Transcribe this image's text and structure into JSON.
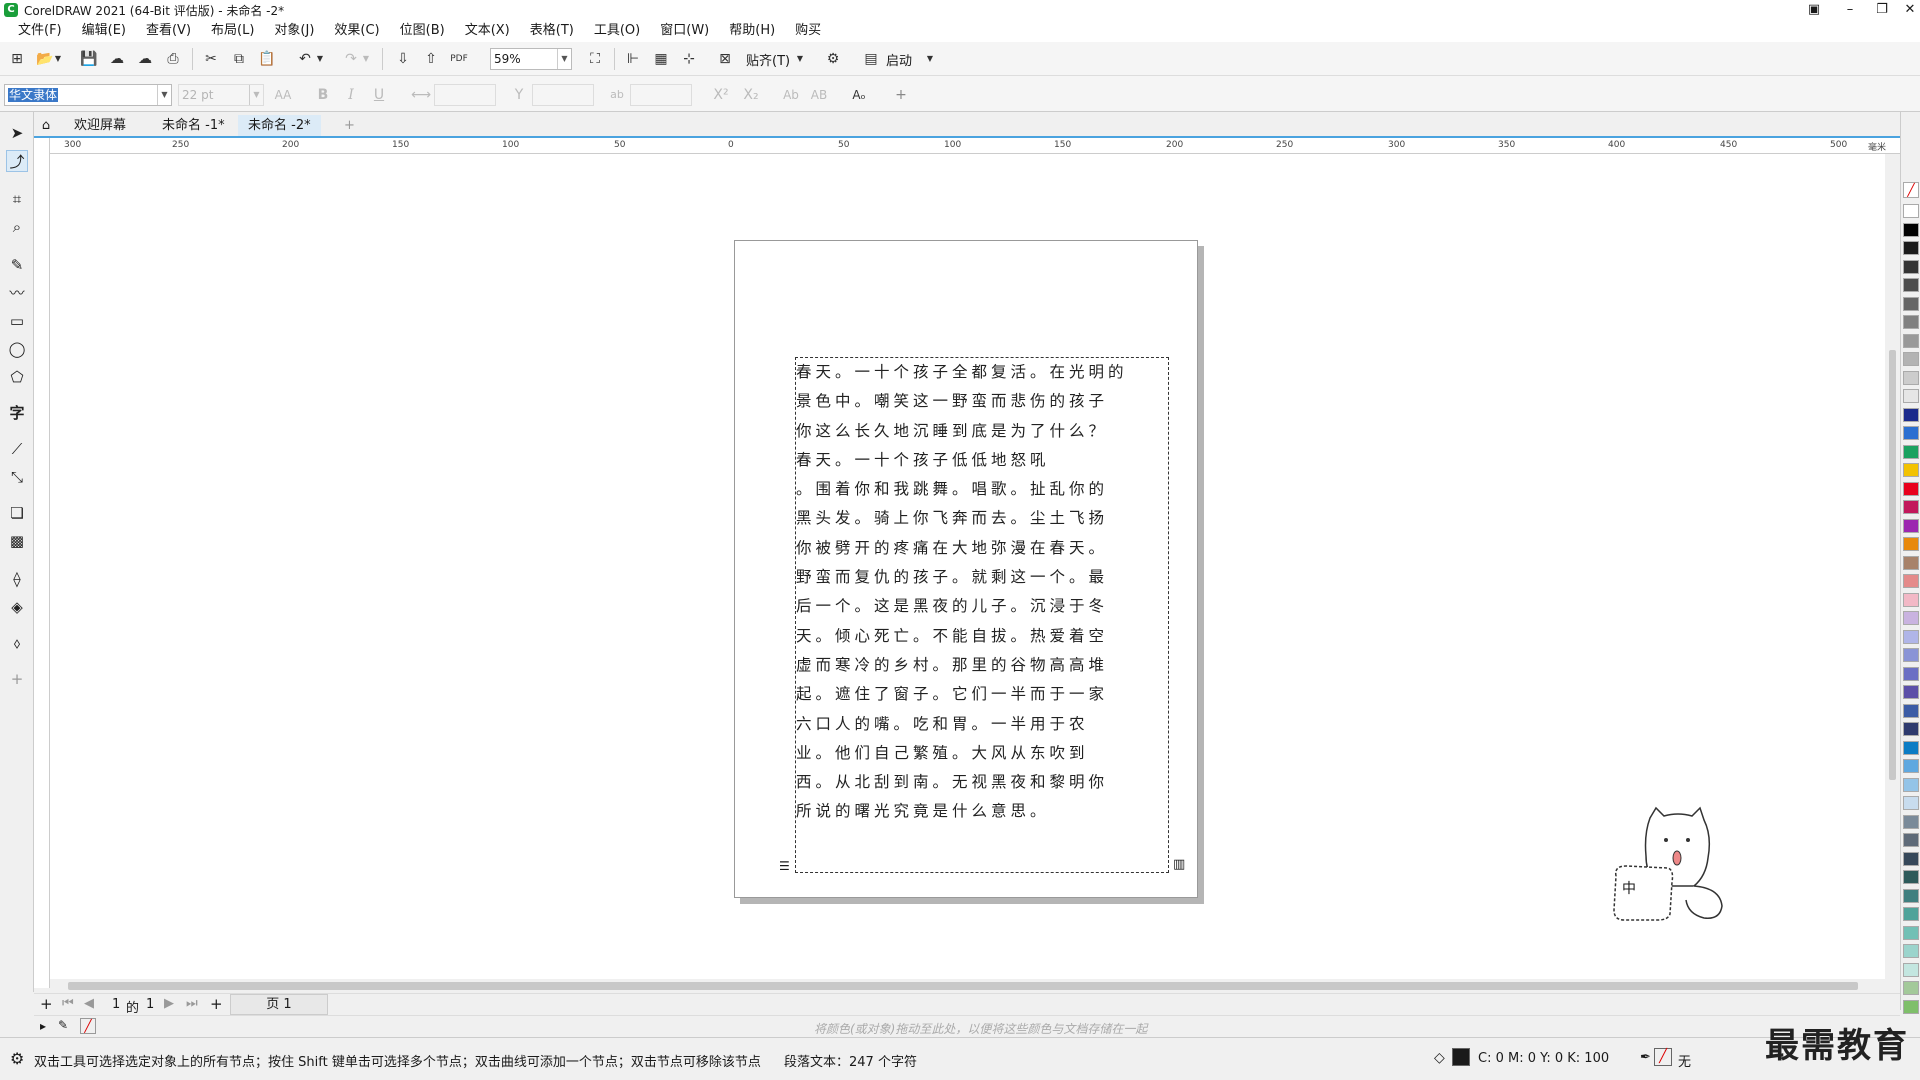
{
  "window": {
    "title": "CorelDRAW 2021 (64-Bit 评估版) - 未命名 -2*",
    "controls": [
      "minimize",
      "restore",
      "close"
    ]
  },
  "menu": [
    "文件(F)",
    "编辑(E)",
    "查看(V)",
    "布局(L)",
    "对象(J)",
    "效果(C)",
    "位图(B)",
    "文本(X)",
    "表格(T)",
    "工具(O)",
    "窗口(W)",
    "帮助(H)",
    "购买"
  ],
  "toolbar1": {
    "zoom_value": "59%",
    "snap_label": "贴齐(T)",
    "launch_label": "启动",
    "pdf_label": "PDF"
  },
  "toolbar2": {
    "font_name": "华文隶体",
    "font_size": "22 pt",
    "bold": "B",
    "italic": "I",
    "underline": "U",
    "superscript": "X²",
    "subscript": "X₂"
  },
  "tabs": [
    "欢迎屏幕",
    "未命名 -1*",
    "未命名 -2*"
  ],
  "ruler_labels": [
    "300",
    "250",
    "200",
    "150",
    "100",
    "50",
    "0",
    "50",
    "100",
    "150",
    "200",
    "250",
    "300",
    "350",
    "400",
    "450",
    "500"
  ],
  "ruler_unit": "毫米",
  "document_text": [
    "春天。一十个孩子全都复活。在光明的",
    "景色中。嘲笑这一野蛮而悲伤的孩子",
    "你这么长久地沉睡到底是为了什么？",
    "春天。一十个孩子低低地怒吼",
    "。围着你和我跳舞。唱歌。扯乱你的",
    "黑头发。骑上你飞奔而去。尘土飞扬",
    "你被劈开的疼痛在大地弥漫在春天。",
    "野蛮而复仇的孩子。就剩这一个。最",
    "后一个。这是黑夜的儿子。沉浸于冬",
    "天。倾心死亡。不能自拔。热爱着空",
    "虚而寒冷的乡村。那里的谷物高高堆",
    "起。遮住了窗子。它们一半而于一家",
    "六口人的嘴。吃和胃。一半用于农",
    "业。他们自己繁殖。大风从东吹到",
    "西。从北刮到南。无视黑夜和黎明你",
    "所说的曙光究竟是什么意思。"
  ],
  "page_nav": {
    "current": "1",
    "of_label": "的",
    "total": "1",
    "page_tab": "页 1"
  },
  "doc_palette_hint": "将颜色(或对象)拖动至此处，以便将这些颜色与文档存储在一起",
  "status": {
    "hint": "双击工具可选择选定对象上的所有节点；按住 Shift 键单击可选择多个节点；双击曲线可添加一个节点；双击节点可移除该节点",
    "object_info": "段落文本：247 个字符",
    "fill": "C: 0 M: 0 Y: 0 K: 100",
    "outline": "无"
  },
  "mascot_badge": "中",
  "watermark": "最需教育",
  "colors": {
    "accent": "#4aa3df",
    "palette": [
      "#ffffff",
      "#000000",
      "#1a1a1a",
      "#333333",
      "#4d4d4d",
      "#666666",
      "#808080",
      "#999999",
      "#b3b3b3",
      "#cccccc",
      "#e6e6e6",
      "#1b2a8c",
      "#2a6fd1",
      "#1aa260",
      "#f2c200",
      "#e8001c",
      "#c2185b",
      "#9c27b0",
      "#e8890c",
      "#a8826a",
      "#e48a8a",
      "#f2b8c6",
      "#c9b3e0",
      "#b0b5e8",
      "#8a94d6",
      "#6b6fc4",
      "#5c4fa8",
      "#3b5ba5",
      "#2e3a6e",
      "#0b7cc4",
      "#5fa8e0",
      "#94c4e8",
      "#c8dcee",
      "#7a8a99",
      "#5e6a78",
      "#36485a",
      "#2d5a5a",
      "#3f7f7f",
      "#4fa39a",
      "#72c0b5",
      "#9bd4cc",
      "#c3e6e0",
      "#a3c99a",
      "#7fbf6a"
    ]
  }
}
